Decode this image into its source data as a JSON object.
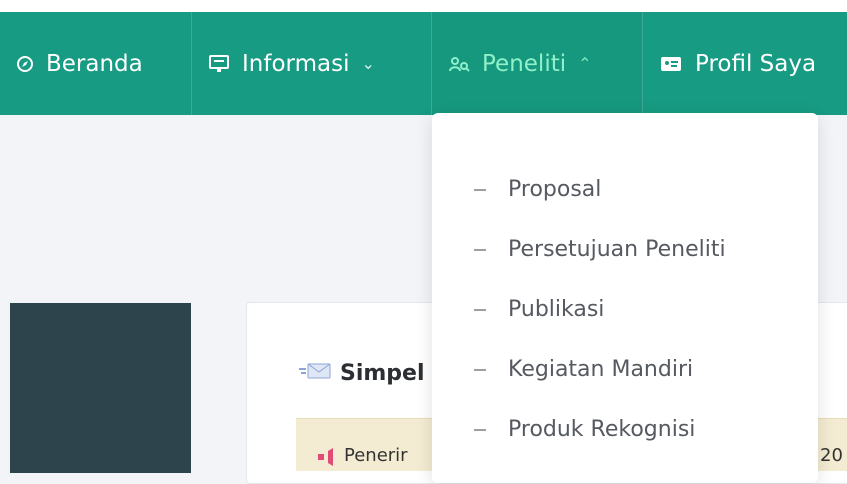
{
  "nav": {
    "items": [
      {
        "label": "Beranda",
        "icon": "compass-icon"
      },
      {
        "label": "Informasi",
        "icon": "monitor-icon",
        "has_dropdown": true
      },
      {
        "label": "Peneliti",
        "icon": "user-search-icon",
        "has_dropdown": true,
        "active": true
      },
      {
        "label": "Profil Saya",
        "icon": "id-card-icon"
      }
    ]
  },
  "dropdown": {
    "items": [
      "Proposal",
      "Persetujuan Peneliti",
      "Publikasi",
      "Kegiatan Mandiri",
      "Produk Rekognisi"
    ]
  },
  "panel": {
    "title": "Simpel",
    "notice_text": "Penerir",
    "notice_right": "20"
  },
  "colors": {
    "navbar": "#179b82",
    "active_text": "#8ff0c9",
    "panel_bg": "#ffffff",
    "left_card": "#2d444c",
    "notice_bg": "#f3ecd2"
  }
}
